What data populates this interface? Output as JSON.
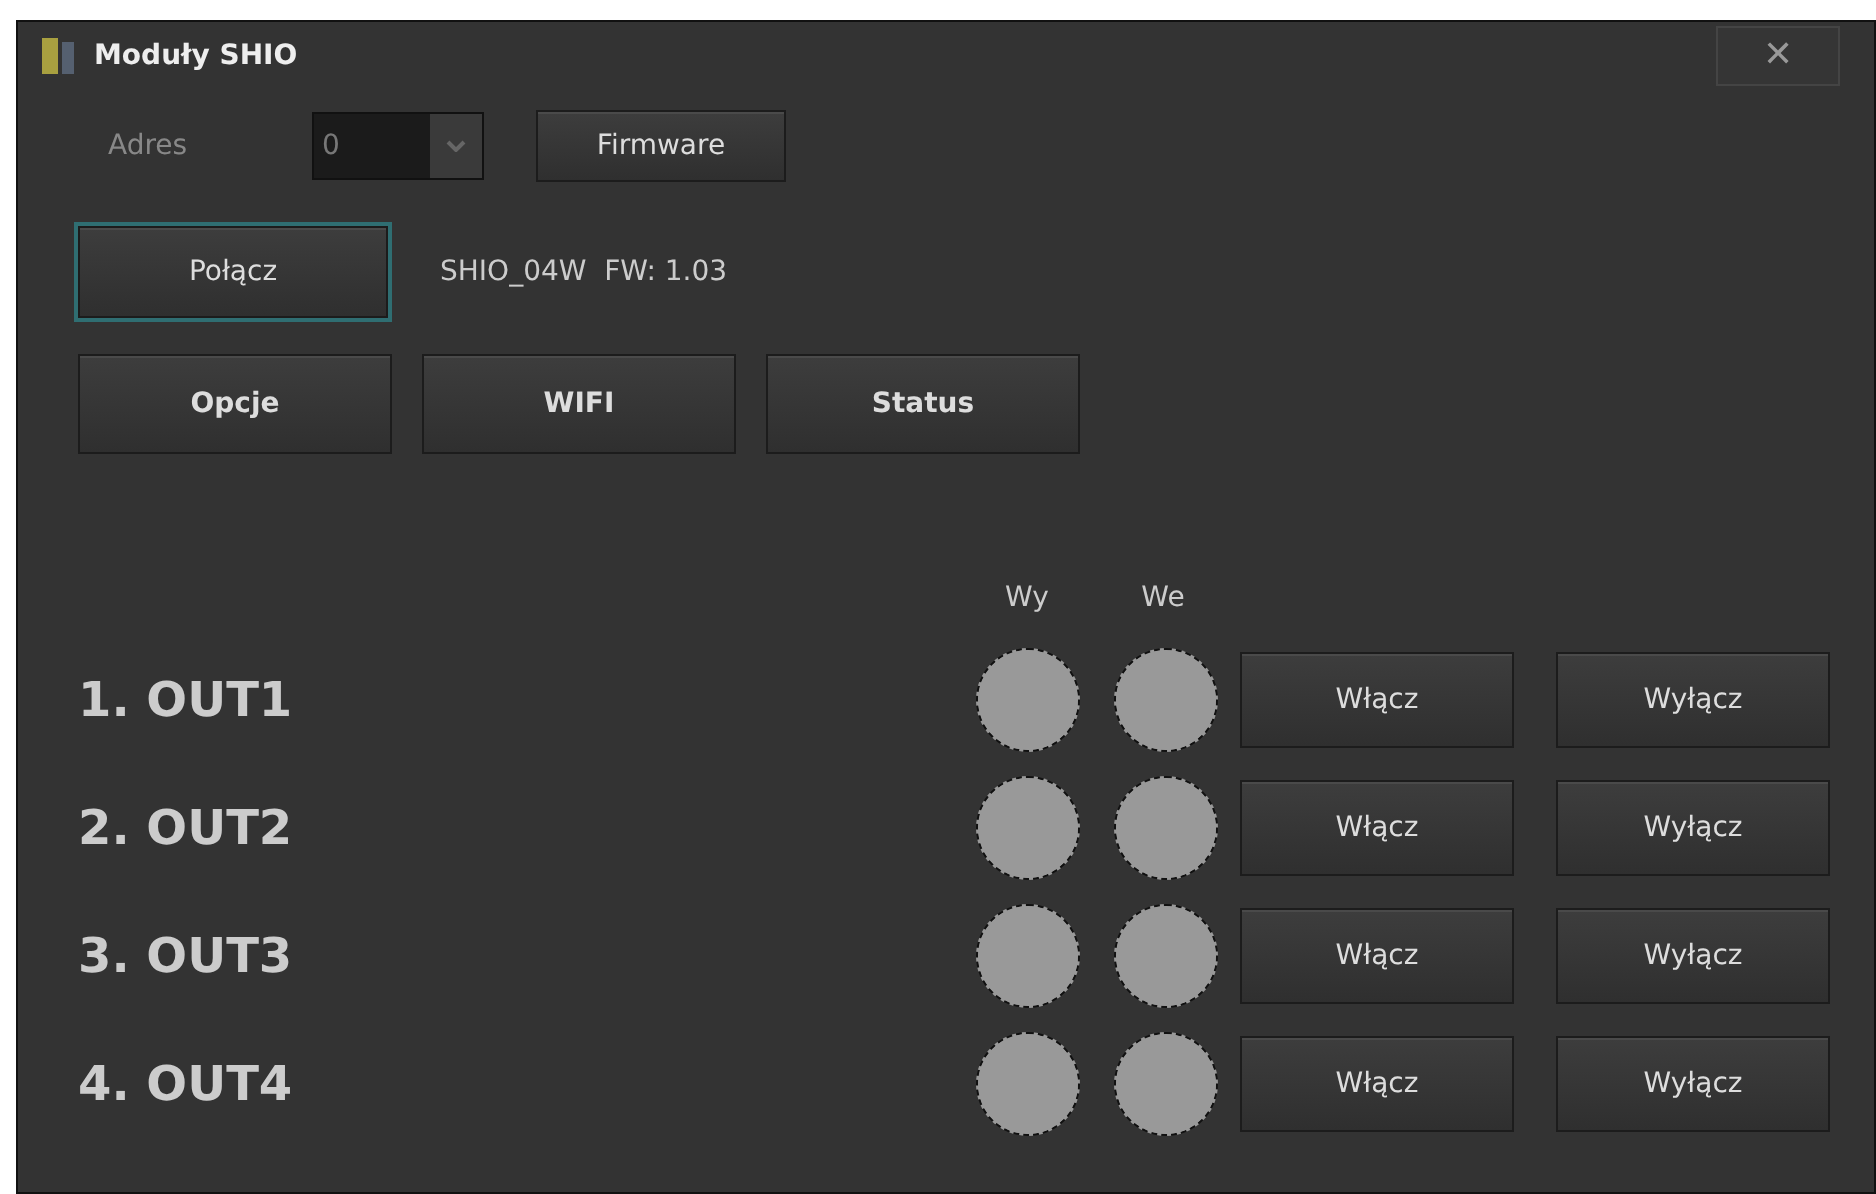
{
  "window": {
    "title": "Moduły SHIO",
    "close": "✕"
  },
  "address": {
    "label": "Adres",
    "value": "0",
    "disabled": true
  },
  "firmware_button": "Firmware",
  "connect_button": {
    "label": "Połącz",
    "focused": true
  },
  "device_info": "SHIO_04W  FW: 1.03",
  "option_buttons": [
    "Opcje",
    "WIFI",
    "Status"
  ],
  "columns": [
    "Wy",
    "We"
  ],
  "outputs": [
    {
      "name": "1. OUT1",
      "out_on": false,
      "in_on": false,
      "on_button": "Włącz",
      "off_button": "Wyłącz"
    },
    {
      "name": "2. OUT2",
      "out_on": false,
      "in_on": false,
      "on_button": "Włącz",
      "off_button": "Wyłącz"
    },
    {
      "name": "3. OUT3",
      "out_on": false,
      "in_on": false,
      "on_button": "Włącz",
      "off_button": "Wyłącz"
    },
    {
      "name": "4. OUT4",
      "out_on": false,
      "in_on": false,
      "on_button": "Włącz",
      "off_button": "Wyłącz"
    }
  ]
}
